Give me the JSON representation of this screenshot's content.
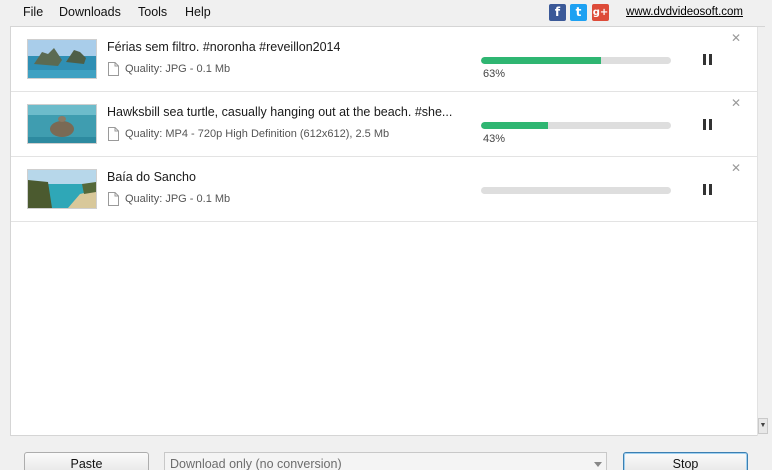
{
  "menu": [
    {
      "label": "File"
    },
    {
      "label": "Downloads"
    },
    {
      "label": "Tools"
    },
    {
      "label": "Help"
    }
  ],
  "social": {
    "facebook": {
      "glyph": "f",
      "color": "#3b5998",
      "icon": "facebook-icon"
    },
    "twitter": {
      "glyph": "t",
      "color": "#1da1f2",
      "icon": "twitter-icon"
    },
    "googleplus": {
      "glyph": "g+",
      "color": "#dd4b39",
      "icon": "google-plus-icon"
    }
  },
  "site_link": "www.dvdvideosoft.com",
  "downloads": [
    {
      "title": "Férias sem filtro. #noronha #reveillon2014",
      "quality": "Quality: JPG - 0.1 Mb",
      "progress": 0.63,
      "percent_label": "63%",
      "thumb": "beach-rocks"
    },
    {
      "title": "Hawksbill sea turtle, casually hanging out at the beach. #she...",
      "quality": "Quality: MP4 - 720p High Definition (612x612), 2.5 Mb",
      "progress": 0.35,
      "percent_label": "43%",
      "thumb": "sea-turtle"
    },
    {
      "title": "Baía do Sancho",
      "quality": "Quality: JPG - 0.1 Mb",
      "progress": 0,
      "percent_label": "",
      "thumb": "bay-cliffs"
    }
  ],
  "bottom": {
    "paste_label": "Paste",
    "conversion_value": "Download only (no conversion)",
    "stop_label": "Stop"
  },
  "colors": {
    "progress": "#2fb672",
    "accent_border": "#3c7fb1"
  }
}
